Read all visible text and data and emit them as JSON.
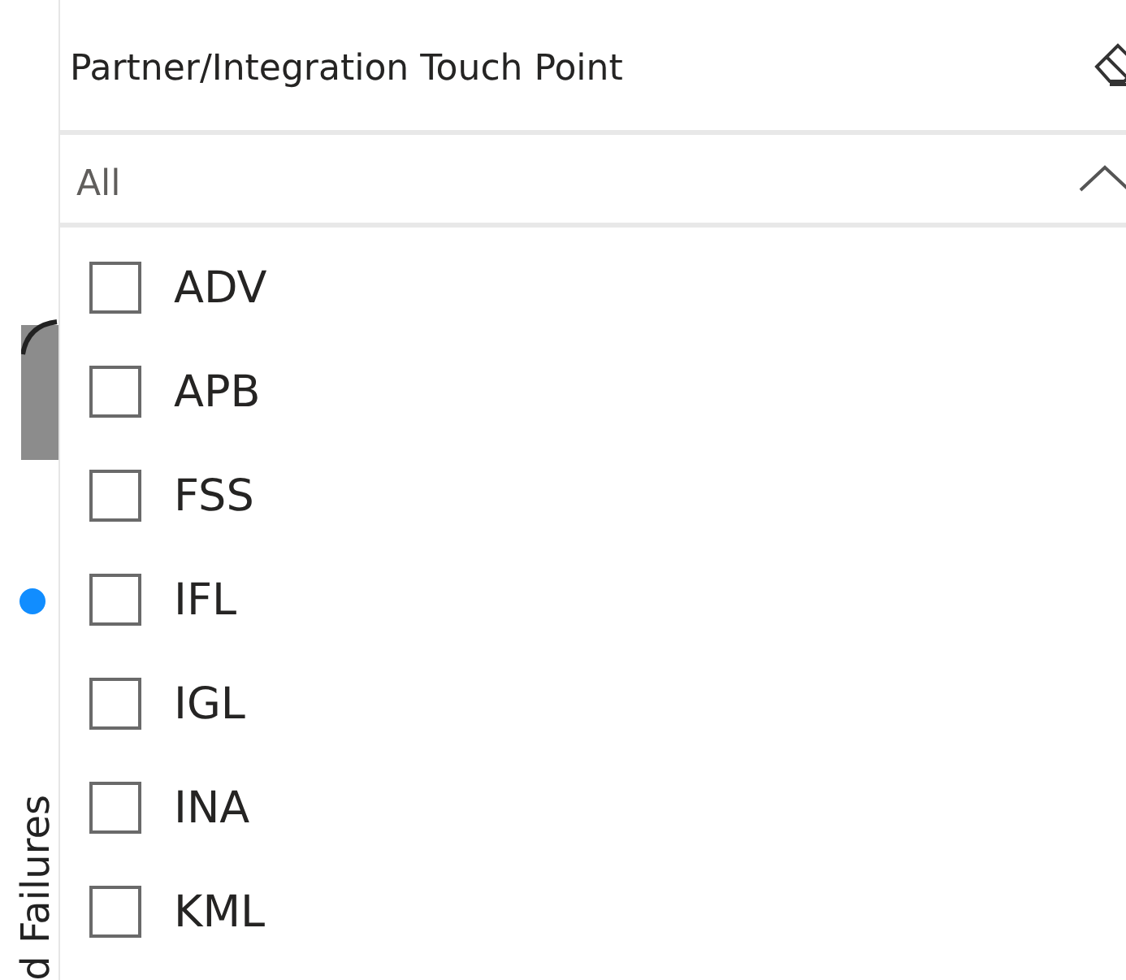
{
  "background_chart": {
    "axis_title": "d Failures"
  },
  "slicer": {
    "title": "Partner/Integration Touch Point",
    "dropdown": {
      "value": "All",
      "expanded": true
    },
    "items": [
      {
        "label": "ADV",
        "checked": false
      },
      {
        "label": "APB",
        "checked": false
      },
      {
        "label": "FSS",
        "checked": false
      },
      {
        "label": "IFL",
        "checked": false
      },
      {
        "label": "IGL",
        "checked": false
      },
      {
        "label": "INA",
        "checked": false
      },
      {
        "label": "KML",
        "checked": false
      }
    ]
  }
}
